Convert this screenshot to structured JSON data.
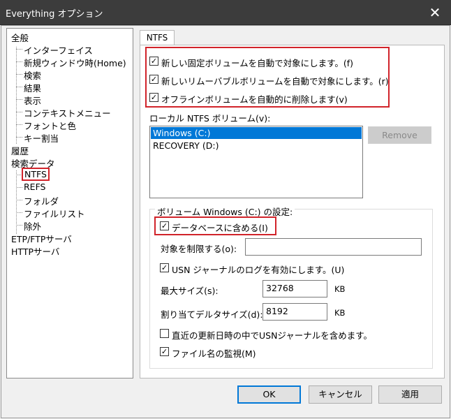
{
  "window": {
    "title": "Everything オプション",
    "close_glyph": "✕"
  },
  "tree": {
    "items": [
      {
        "label": "全般",
        "level": 0
      },
      {
        "label": "インターフェイス",
        "level": 1
      },
      {
        "label": "新規ウィンドウ時(Home)",
        "level": 1
      },
      {
        "label": "検索",
        "level": 1
      },
      {
        "label": "結果",
        "level": 1
      },
      {
        "label": "表示",
        "level": 1
      },
      {
        "label": "コンテキストメニュー",
        "level": 1
      },
      {
        "label": "フォントと色",
        "level": 1
      },
      {
        "label": "キー割当",
        "level": 1
      },
      {
        "label": "履歴",
        "level": 0
      },
      {
        "label": "検索データ",
        "level": 0
      },
      {
        "label": "NTFS",
        "level": 1,
        "selected": true
      },
      {
        "label": "REFS",
        "level": 1
      },
      {
        "label": "フォルダ",
        "level": 1
      },
      {
        "label": "ファイルリスト",
        "level": 1
      },
      {
        "label": "除外",
        "level": 1
      },
      {
        "label": "ETP/FTPサーバ",
        "level": 0
      },
      {
        "label": "HTTPサーバ",
        "level": 0
      }
    ]
  },
  "tab": {
    "label": "NTFS"
  },
  "checks": {
    "auto_fixed": {
      "label": "新しい固定ボリュームを自動で対象にします。(f)",
      "checked": true
    },
    "auto_removable": {
      "label": "新しいリムーバブルボリュームを自動で対象にします。(r)",
      "checked": true
    },
    "auto_remove_offline": {
      "label": "オフラインボリュームを自動的に削除します(v)",
      "checked": true
    }
  },
  "volumes": {
    "label": "ローカル NTFS ボリューム(v):",
    "items": [
      "Windows (C:)",
      "RECOVERY (D:)"
    ],
    "selected": "Windows (C:)",
    "remove_button": "Remove"
  },
  "settings": {
    "group_label": "ボリューム Windows (C:) の設定:",
    "include_db": {
      "label": "データベースに含める(I)",
      "checked": true
    },
    "limit_label": "対象を制限する(o):",
    "limit_value": "",
    "usn_enable": {
      "label": "USN ジャーナルのログを有効にします。(U)",
      "checked": true
    },
    "max_size_label": "最大サイズ(s):",
    "max_size_value": "32768",
    "max_size_unit": "KB",
    "delta_label": "割り当てデルタサイズ(d):",
    "delta_value": "8192",
    "delta_unit": "KB",
    "recent_usn": {
      "label": "直近の更新日時の中でUSNジャーナルを含めます。",
      "checked": false
    },
    "monitor_names": {
      "label": "ファイル名の監視(M)",
      "checked": true
    }
  },
  "buttons": {
    "ok": "OK",
    "cancel": "キャンセル",
    "apply": "適用"
  },
  "colors": {
    "highlight": "#d1232a",
    "selection": "#0078d7",
    "titlebar": "#3c3c3c"
  }
}
